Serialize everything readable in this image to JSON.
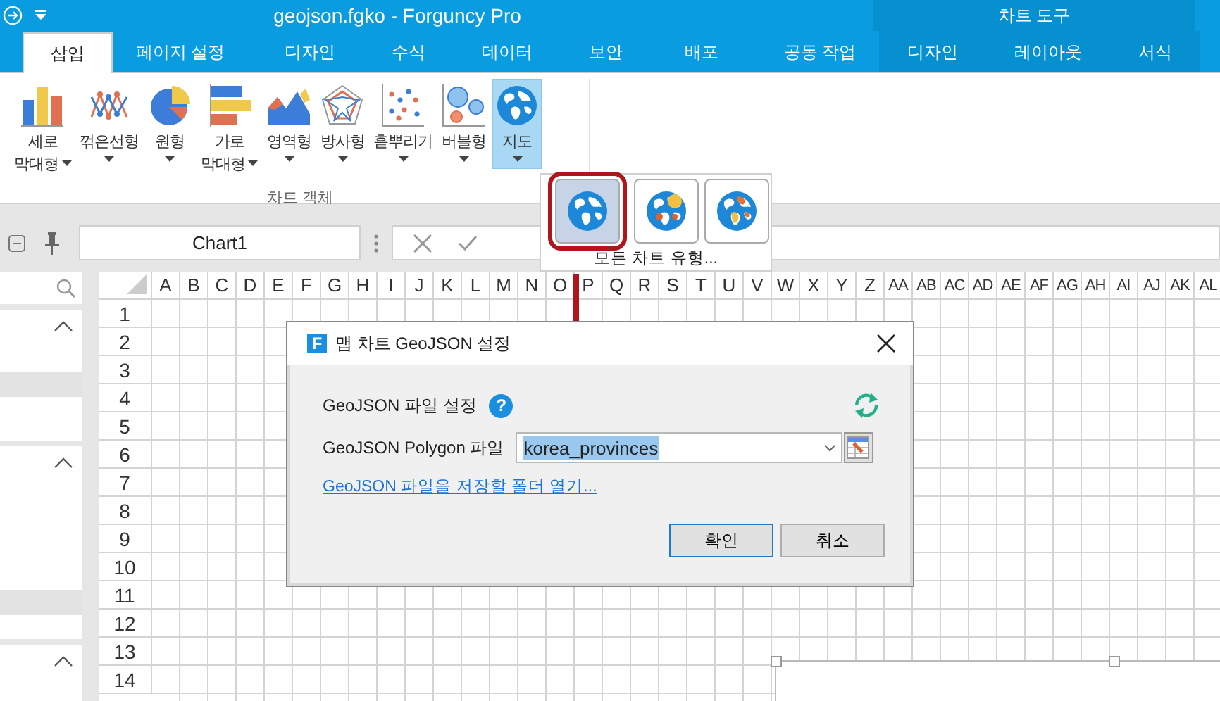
{
  "title_bar": {
    "title": "geojson.fgko - Forguncy Pro",
    "context_title": "차트 도구"
  },
  "tabs": [
    {
      "label": "삽입",
      "selected": true,
      "contextual": false
    },
    {
      "label": "페이지 설정",
      "selected": false,
      "contextual": false
    },
    {
      "label": "디자인",
      "selected": false,
      "contextual": false
    },
    {
      "label": "수식",
      "selected": false,
      "contextual": false
    },
    {
      "label": "데이터",
      "selected": false,
      "contextual": false
    },
    {
      "label": "보안",
      "selected": false,
      "contextual": false
    },
    {
      "label": "배포",
      "selected": false,
      "contextual": false
    },
    {
      "label": "공동 작업",
      "selected": false,
      "contextual": false
    },
    {
      "label": "디자인",
      "selected": false,
      "contextual": true
    },
    {
      "label": "레이아웃",
      "selected": false,
      "contextual": true
    },
    {
      "label": "서식",
      "selected": false,
      "contextual": true
    }
  ],
  "chart_group": {
    "label": "차트 객체",
    "buttons": [
      {
        "kind": "column",
        "lines": [
          "세로",
          "막대형"
        ],
        "dropdown": true,
        "selected": false
      },
      {
        "kind": "line",
        "lines": [
          "꺾은선형"
        ],
        "dropdown": true,
        "selected": false
      },
      {
        "kind": "pie",
        "lines": [
          "원형"
        ],
        "dropdown": true,
        "selected": false
      },
      {
        "kind": "bar",
        "lines": [
          "가로",
          "막대형"
        ],
        "dropdown": true,
        "selected": false
      },
      {
        "kind": "area",
        "lines": [
          "영역형"
        ],
        "dropdown": true,
        "selected": false
      },
      {
        "kind": "radar",
        "lines": [
          "방사형"
        ],
        "dropdown": true,
        "selected": false
      },
      {
        "kind": "scatter",
        "lines": [
          "흩뿌리기"
        ],
        "dropdown": true,
        "selected": false
      },
      {
        "kind": "bubble",
        "lines": [
          "버블형"
        ],
        "dropdown": true,
        "selected": false
      },
      {
        "kind": "map",
        "lines": [
          "지도"
        ],
        "dropdown": true,
        "selected": true
      }
    ]
  },
  "map_gallery": {
    "options": [
      {
        "kind": "filled",
        "selected": true
      },
      {
        "kind": "bubble",
        "selected": false
      },
      {
        "kind": "heat",
        "selected": false
      }
    ],
    "more": "모든 차트 유형..."
  },
  "formula_bar": {
    "name_box": "Chart1"
  },
  "side_panel": {
    "sections": [
      {
        "expanded": true
      },
      {
        "expanded": true
      },
      {
        "expanded": true
      }
    ]
  },
  "sheet": {
    "columns": [
      "A",
      "B",
      "C",
      "D",
      "E",
      "F",
      "G",
      "H",
      "I",
      "J",
      "K",
      "L",
      "M",
      "N",
      "O",
      "P",
      "Q",
      "R",
      "S",
      "T",
      "U",
      "V",
      "W",
      "X",
      "Y",
      "Z",
      "AA",
      "AB",
      "AC",
      "AD",
      "AE",
      "AF",
      "AG",
      "AH",
      "AI",
      "AJ",
      "AK",
      "AL"
    ],
    "rows": [
      "1",
      "2",
      "3",
      "4",
      "5",
      "6",
      "7",
      "8",
      "9",
      "10",
      "11",
      "12",
      "13",
      "14"
    ]
  },
  "dialog": {
    "logo": "F",
    "title": "맵 차트 GeoJSON 설정",
    "section_label": "GeoJSON 파일 설정",
    "help": "?",
    "field_label": "GeoJSON Polygon 파일",
    "field_value": "korea_provinces",
    "value_selected": true,
    "link": "GeoJSON 파일을 저장할 폴더 열기...",
    "buttons": [
      {
        "label": "확인",
        "default": true
      },
      {
        "label": "취소",
        "default": false
      }
    ]
  }
}
